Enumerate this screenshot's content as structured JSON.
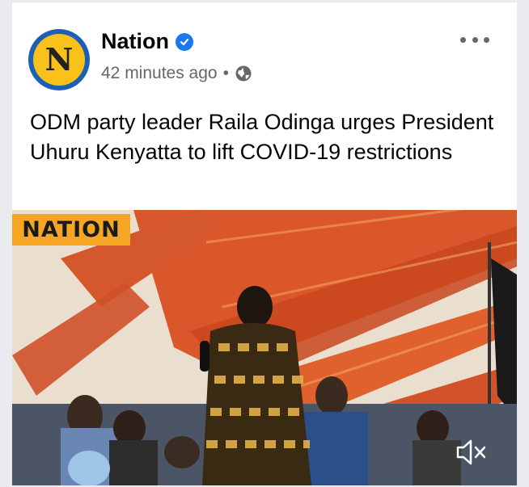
{
  "post": {
    "page_name": "Nation",
    "avatar_letter": "N",
    "time": "42 minutes ago",
    "separator": "•",
    "text": "ODM party leader Raila Odinga urges President Uhuru Kenyatta to lift COVID-19 restrictions"
  },
  "media": {
    "watermark": "NATION"
  },
  "icons": {
    "verified": "verified-badge-icon",
    "audience": "globe-icon",
    "more": "more-options-icon",
    "mute": "muted-speaker-icon"
  },
  "colors": {
    "verified_blue": "#1877f2",
    "avatar_ring": "#1c5fb8",
    "avatar_fill": "#f8c21a",
    "watermark_bg": "#f5a623",
    "meta_gray": "#65676b"
  }
}
